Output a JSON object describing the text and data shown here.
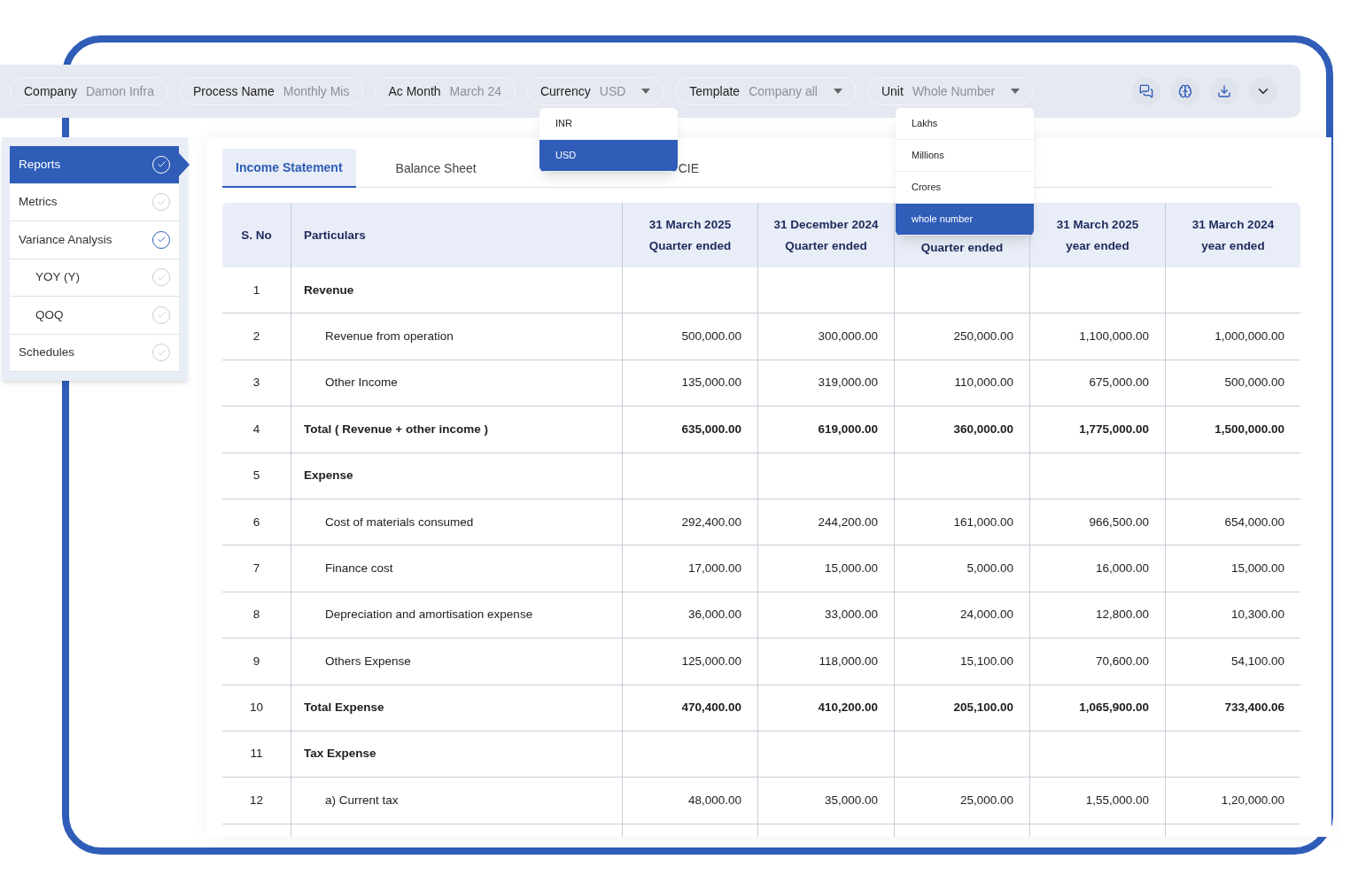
{
  "filters": [
    {
      "label": "Company",
      "value": "Damon Infra",
      "dropdown": false
    },
    {
      "label": "Process Name",
      "value": "Monthly Mis",
      "dropdown": false
    },
    {
      "label": "Ac Month",
      "value": "March 24",
      "dropdown": false
    },
    {
      "label": "Currency",
      "value": "USD",
      "dropdown": true,
      "options": [
        {
          "label": "INR",
          "selected": false
        },
        {
          "label": "USD",
          "selected": true
        }
      ]
    },
    {
      "label": "Template",
      "value": "Company all",
      "dropdown": true
    },
    {
      "label": "Unit",
      "value": "Whole Number",
      "dropdown": true,
      "options": [
        {
          "label": "Lakhs",
          "selected": false
        },
        {
          "label": "Millions",
          "selected": false
        },
        {
          "label": "Crores",
          "selected": false
        },
        {
          "label": "whole number",
          "selected": true
        }
      ]
    }
  ],
  "toolbar_actions": [
    {
      "kind": "chat"
    },
    {
      "kind": "brain"
    },
    {
      "kind": "download"
    },
    {
      "kind": "expand"
    }
  ],
  "sidebar": {
    "items": [
      {
        "label": "Reports",
        "selected": true,
        "checked": true
      },
      {
        "label": "Metrics",
        "selected": false,
        "checked": false
      },
      {
        "label": "Variance Analysis",
        "selected": false,
        "checked": true,
        "children": [
          {
            "label": "YOY (Y)",
            "selected": false,
            "checked": false
          },
          {
            "label": "QOQ",
            "selected": false,
            "checked": false
          }
        ]
      },
      {
        "label": "Schedules",
        "selected": false,
        "checked": false
      }
    ]
  },
  "tabs": [
    {
      "label": "Income Statement",
      "selected": true
    },
    {
      "label": "Balance Sheet",
      "selected": false
    },
    {
      "label": "CIE",
      "selected": false
    }
  ],
  "table": {
    "columns": [
      [
        "S. No"
      ],
      [
        "Particulars"
      ],
      [
        "31 March 2025",
        "Quarter ended"
      ],
      [
        "31 December 2024",
        "Quarter ended"
      ],
      [
        "Quarter ended"
      ],
      [
        "31 March 2025",
        "year ended"
      ],
      [
        "31 March 2024",
        "year ended"
      ]
    ],
    "rows": [
      {
        "kind": "heading",
        "no": "1",
        "particular": "Revenue",
        "values": []
      },
      {
        "kind": "item",
        "no": "2",
        "particular": "Revenue from operation",
        "values": [
          "500,000.00",
          "300,000.00",
          "250,000.00",
          "1,100,000.00",
          "1,000,000.00"
        ]
      },
      {
        "kind": "item",
        "no": "3",
        "particular": "Other Income",
        "values": [
          "135,000.00",
          "319,000.00",
          "110,000.00",
          "675,000.00",
          "500,000.00"
        ]
      },
      {
        "kind": "total",
        "no": "4",
        "particular": "Total **(** Revenue + other income **)**",
        "values": [
          "635,000.00",
          "619,000.00",
          "360,000.00",
          "1,775,000.00",
          "1,500,000.00"
        ]
      },
      {
        "kind": "heading",
        "no": "5",
        "particular": "Expense",
        "values": []
      },
      {
        "kind": "item",
        "no": "6",
        "particular": "Cost of materials consumed",
        "values": [
          "292,400.00",
          "244,200.00",
          "161,000.00",
          "966,500.00",
          "654,000.00"
        ]
      },
      {
        "kind": "item",
        "no": "7",
        "particular": "Finance cost",
        "values": [
          "17,000.00",
          "15,000.00",
          "5,000.00",
          "16,000.00",
          "15,000.00"
        ]
      },
      {
        "kind": "item",
        "no": "8",
        "particular": "Depreciation and amortisation expense",
        "values": [
          "36,000.00",
          "33,000.00",
          "24,000.00",
          "12,800.00",
          "10,300.00"
        ]
      },
      {
        "kind": "item",
        "no": "9",
        "particular": "Others Expense",
        "values": [
          "125,000.00",
          "118,000.00",
          "15,100.00",
          "70,600.00",
          "54,100.00"
        ]
      },
      {
        "kind": "total",
        "no": "10",
        "particular": "Total Expense",
        "values": [
          "470,400.00",
          "410,200.00",
          "205,100.00",
          "1,065,900.00",
          "733,400.06"
        ]
      },
      {
        "kind": "heading",
        "no": "11",
        "particular": "Tax Expense",
        "values": []
      },
      {
        "kind": "item",
        "no": "12",
        "particular": "a) Current tax",
        "values": [
          "48,000.00",
          "35,000.00",
          "25,000.00",
          "1,55,000.00",
          "1,20,000.00"
        ]
      }
    ]
  }
}
